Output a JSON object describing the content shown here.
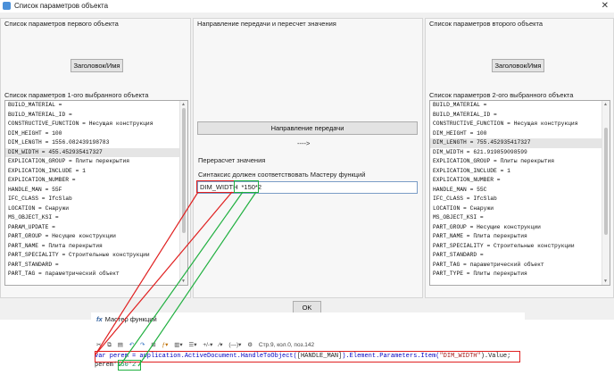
{
  "window": {
    "title": "Список параметров объекта"
  },
  "left": {
    "header": "Список параметров первого объекта",
    "button": "Заголовок/Имя",
    "list_title": "Список параметров 1-ого выбранного объекта",
    "rows": [
      "BUILD_MATERIAL =",
      "BUILD_MATERIAL_ID =",
      "CONSTRUCTIVE_FUNCTION = Несущая конструкция",
      "DIM_HEIGHT = 100",
      "DIM_LENGTH = 1556.082439198783",
      "DIM_WIDTH = 455.452935417327",
      "EXPLICATION_GROUP = Плиты перекрытия",
      "EXPLICATION_INCLUDE = 1",
      "EXPLICATION_NUMBER =",
      "HANDLE_MAN = 55F",
      "IFC_CLASS = IfcSlab",
      "LOCATION = Снаружи",
      "MS_OBJECT_KSI =",
      "PARAM_UPDATE =",
      "PART_GROUP = Несущие конструкции",
      "PART_NAME = Плита перекрытия",
      "PART_SPECIALITY = Строительные конструкции",
      "PART_STANDARD =",
      "PART_TAG = параметрический объект"
    ]
  },
  "middle": {
    "header": "Направление передачи и пересчет значения",
    "direction_button": "Направление передачи",
    "arrow": "---->",
    "recalc_label": "Перерасчет значения",
    "syntax_label": "Синтаксис должен соответствовать Мастеру функций",
    "formula_var": "DIM_WIDTH",
    "formula_expr": "*150*2"
  },
  "right": {
    "header": "Список параметров второго объекта",
    "button": "Заголовок/Имя",
    "list_title": "Список параметров 2-ого выбранного объекта",
    "rows": [
      "BUILD_MATERIAL =",
      "BUILD_MATERIAL_ID =",
      "CONSTRUCTIVE_FUNCTION = Несущая конструкция",
      "DIM_HEIGHT = 100",
      "DIM_LENGTH = 755.452935417327",
      "DIM_WIDTH = 621.919859098599",
      "EXPLICATION_GROUP = Плиты перекрытия",
      "EXPLICATION_INCLUDE = 1",
      "EXPLICATION_NUMBER =",
      "HANDLE_MAN = 55C",
      "IFC_CLASS = IfcSlab",
      "LOCATION = Снаружи",
      "MS_OBJECT_KSI =",
      "PART_GROUP = Несущие конструкции",
      "PART_NAME = Плита перекрытия",
      "PART_SPECIALITY = Строительные конструкции",
      "PART_STANDARD =",
      "PART_TAG = параметрический объект",
      "PART_TYPE = Плиты перекрытия"
    ]
  },
  "ok_button": "OK",
  "master": {
    "title": "Мастер функций",
    "status": "Стр.9, кол.0, поз.142",
    "code_line1": {
      "a": "var perem = application.ActiveDocument.HandleToObject(",
      "b": "[HANDLE_MAN]",
      "c": ").Element.Parameters.Item(",
      "d": "\"DIM_WIDTH\"",
      "e": ").Value;"
    },
    "code_line2": {
      "a": "perem",
      "b": "*150*2"
    }
  },
  "colors": {
    "highlight_red": "#e02020",
    "highlight_green": "#20b040"
  }
}
